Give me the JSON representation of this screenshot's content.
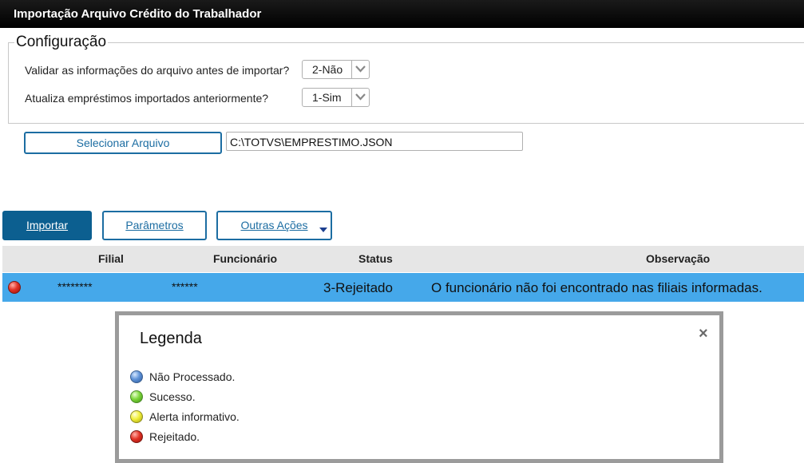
{
  "window": {
    "title": "Importação Arquivo Crédito do Trabalhador"
  },
  "config": {
    "legend": "Configuração",
    "validate_label": "Validar as informações do arquivo antes de importar?",
    "validate_value": "2-Não",
    "update_label": "Atualiza empréstimos importados anteriormente?",
    "update_value": "1-Sim"
  },
  "file": {
    "select_button": "Selecionar Arquivo",
    "path": "C:\\TOTVS\\EMPRESTIMO.JSON"
  },
  "actions": {
    "import_label": "Importar",
    "params_label": "Parâmetros",
    "other_label": "Outras Ações"
  },
  "table": {
    "headers": {
      "filial": "Filial",
      "funcionario": "Funcionário",
      "status": "Status",
      "observacao": "Observação"
    },
    "rows": [
      {
        "status_icon": "red-status-icon",
        "filial": "********",
        "funcionario": "******",
        "status": "3-Rejeitado",
        "observacao": "O funcionário não foi encontrado nas filiais informadas."
      }
    ]
  },
  "legend_dialog": {
    "title": "Legenda",
    "close": "×",
    "items": [
      {
        "color": "blue",
        "label": "Não Processado."
      },
      {
        "color": "green",
        "label": "Sucesso."
      },
      {
        "color": "yellow",
        "label": "Alerta informativo."
      },
      {
        "color": "red",
        "label": "Rejeitado."
      }
    ]
  },
  "colors": {
    "primary": "#0c5f90",
    "accent": "#1c6da2",
    "selected_row": "#45a8ea"
  }
}
